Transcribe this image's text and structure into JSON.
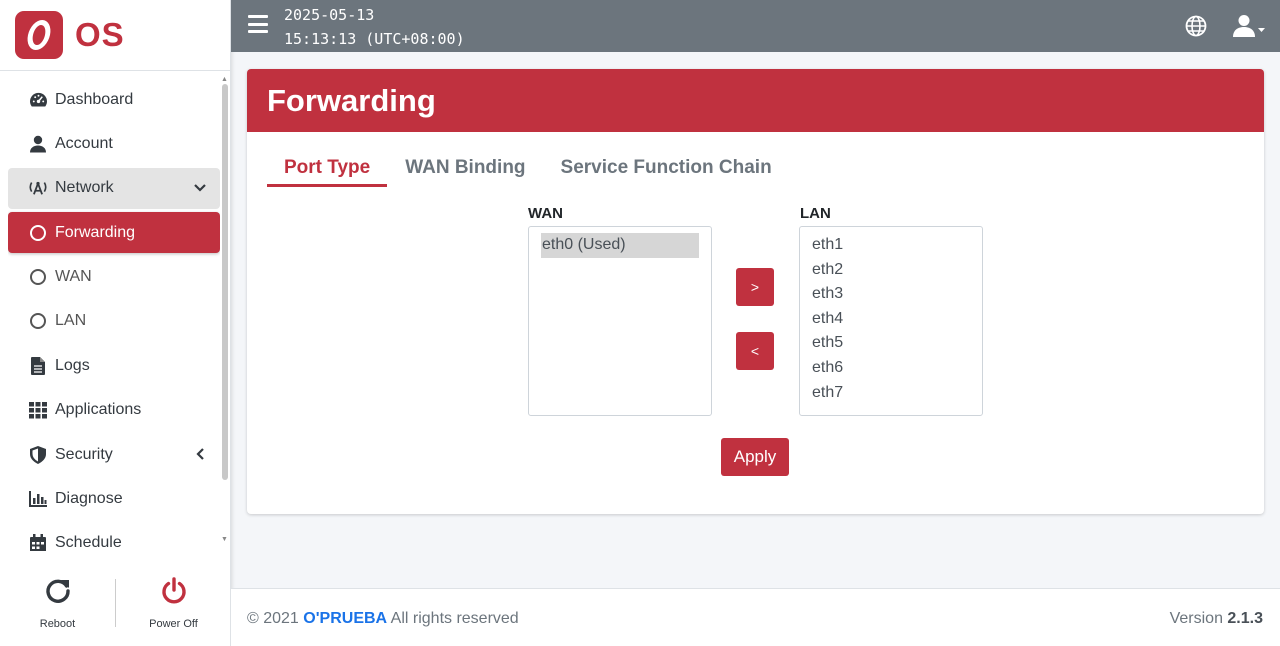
{
  "brand": {
    "name": "OS",
    "color": "#c0313f"
  },
  "header": {
    "date": "2025-05-13",
    "time": "15:13:13 (UTC+08:00)",
    "menu_icon": "hamburger-icon",
    "language_icon": "globe-icon",
    "user_icon": "user-icon"
  },
  "sidebar": {
    "items": [
      {
        "label": "Dashboard",
        "icon": "dashboard-icon"
      },
      {
        "label": "Account",
        "icon": "user-icon"
      },
      {
        "label": "Network",
        "icon": "network-icon",
        "state": "expanded"
      },
      {
        "label": "Forwarding",
        "icon": "circle-icon",
        "state": "active"
      },
      {
        "label": "WAN",
        "icon": "circle-icon"
      },
      {
        "label": "LAN",
        "icon": "circle-icon"
      },
      {
        "label": "Logs",
        "icon": "file-icon"
      },
      {
        "label": "Applications",
        "icon": "grid-icon"
      },
      {
        "label": "Security",
        "icon": "shield-icon",
        "state": "collapsed"
      },
      {
        "label": "Diagnose",
        "icon": "chart-icon"
      },
      {
        "label": "Schedule",
        "icon": "calendar-icon"
      }
    ],
    "reboot_label": "Reboot",
    "poweroff_label": "Power Off"
  },
  "card": {
    "title": "Forwarding",
    "tabs": [
      "Port Type",
      "WAN Binding",
      "Service Function Chain"
    ],
    "active_tab": "Port Type",
    "wan_label": "WAN",
    "lan_label": "LAN",
    "wan_options": [
      "eth0 (Used)"
    ],
    "lan_options": [
      "eth1",
      "eth2",
      "eth3",
      "eth4",
      "eth5",
      "eth6",
      "eth7"
    ],
    "move_right_label": ">",
    "move_left_label": "<",
    "apply_label": "Apply"
  },
  "footer": {
    "copyright_prefix": "© 2021 ",
    "company": "O'PRUEBA",
    "copyright_suffix": " All rights reserved",
    "version_label": "Version ",
    "version": "2.1.3"
  },
  "colors": {
    "accent": "#c0313f",
    "header_bg": "#6c757d",
    "link": "#1a73e8"
  }
}
